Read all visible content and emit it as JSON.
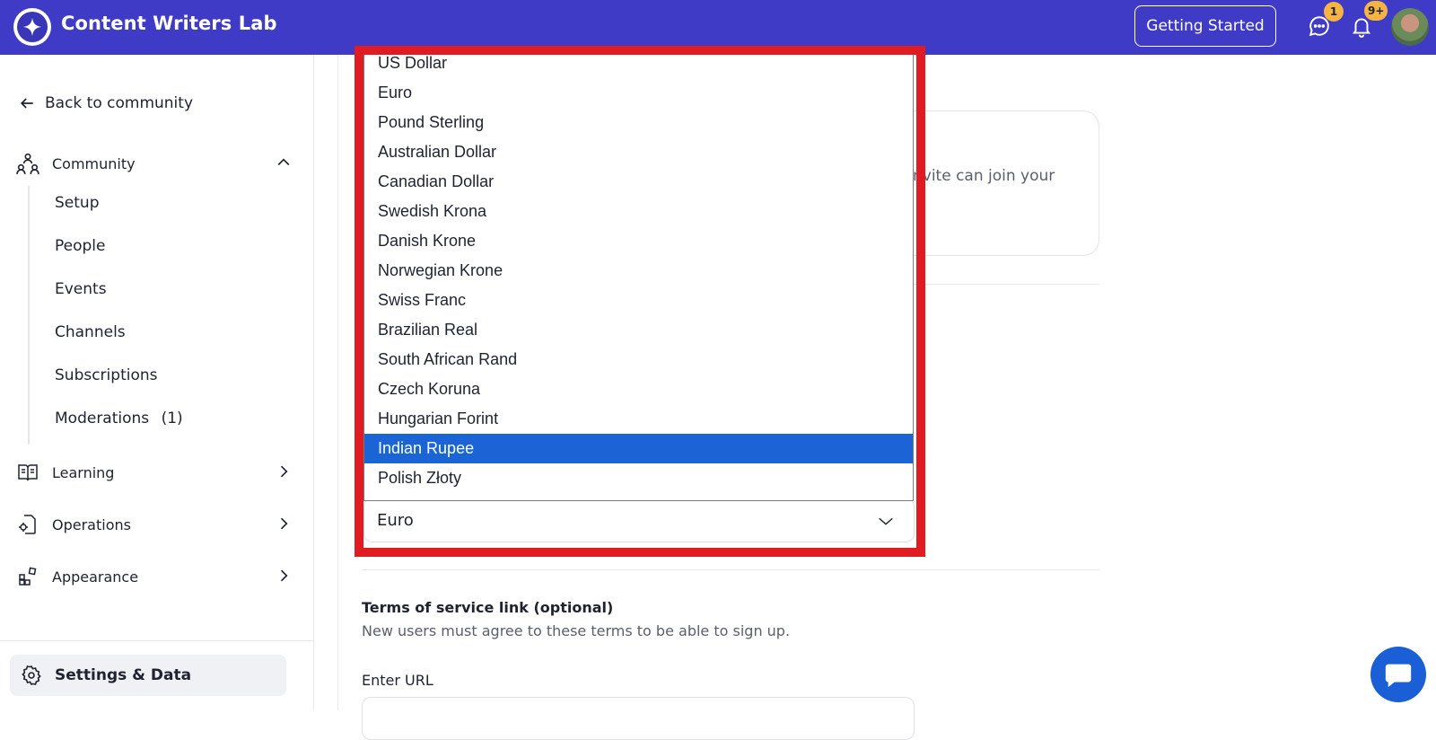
{
  "header": {
    "app_title": "Content Writers Lab",
    "getting_started_label": "Getting Started",
    "messages_badge": "1",
    "notifications_badge": "9+"
  },
  "sidebar": {
    "back_label": "Back to community",
    "community": {
      "label": "Community",
      "items": [
        {
          "label": "Setup"
        },
        {
          "label": "People"
        },
        {
          "label": "Events"
        },
        {
          "label": "Channels"
        },
        {
          "label": "Subscriptions"
        },
        {
          "label": "Moderations",
          "count": "(1)"
        }
      ]
    },
    "learning_label": "Learning",
    "operations_label": "Operations",
    "appearance_label": "Appearance",
    "settings_label": "Settings & Data"
  },
  "main": {
    "card_text": "nvite can join your",
    "currency_selected": "Euro",
    "terms_title": "Terms of service link (optional)",
    "terms_subtitle": "New users must agree to these terms to be able to sign up.",
    "url_label": "Enter URL"
  },
  "currency_dropdown": {
    "options": [
      "US Dollar",
      "Euro",
      "Pound Sterling",
      "Australian Dollar",
      "Canadian Dollar",
      "Swedish Krona",
      "Danish Krone",
      "Norwegian Krone",
      "Swiss Franc",
      "Brazilian Real",
      "South African Rand",
      "Czech Koruna",
      "Hungarian Forint",
      "Indian Rupee",
      "Polish Złoty"
    ],
    "highlighted": "Indian Rupee"
  },
  "colors": {
    "header_bg": "#3f3bc6",
    "selected_option_bg": "#1b64d6",
    "highlight_frame": "#e01b22",
    "badge": "#f6b443"
  }
}
